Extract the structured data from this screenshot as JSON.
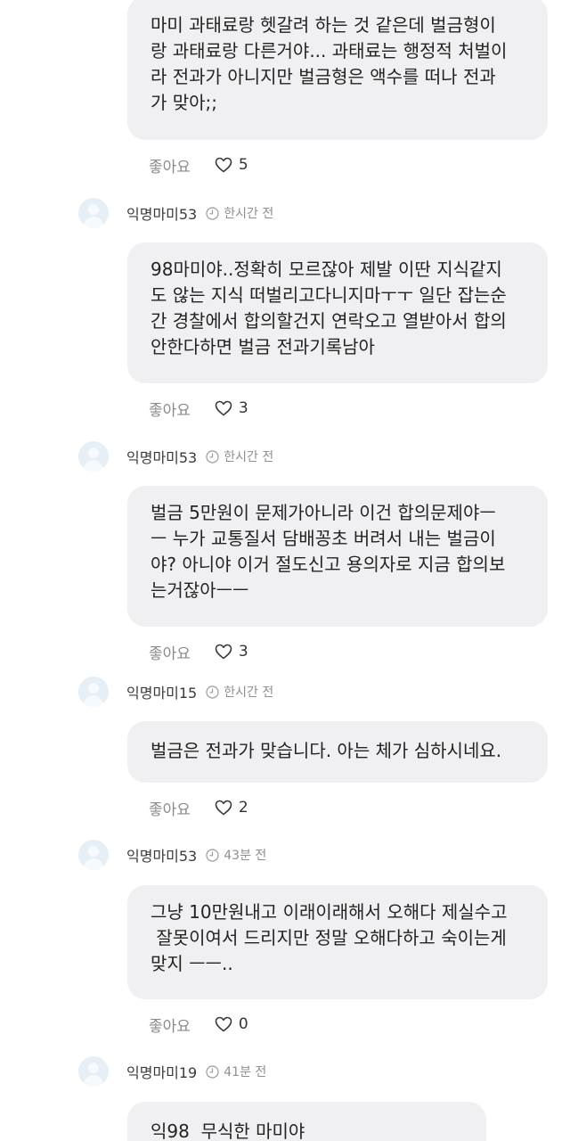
{
  "comments": [
    {
      "username": "",
      "time": "",
      "text": "마미 과태료랑 헷갈려 하는 것 같은데 벌금형이\n랑 과태료랑 다른거야... 과태료는 행정적 처벌이\n라 전과가 아니지만 벌금형은 액수를 떠나 전과\n가 맞아;;",
      "like_label": "좋아요",
      "like_count": "5"
    },
    {
      "username": "익명마미53",
      "time": "한시간 전",
      "text": "98마미야..정확히 모르잖아 제발 이딴 지식같지\n도 않는 지식 떠벌리고다니지마ㅜㅜ 일단 잡는순\n간 경찰에서 합의할건지 연락오고 열받아서 합의\n안한다하면 벌금 전과기록남아",
      "like_label": "좋아요",
      "like_count": "3"
    },
    {
      "username": "익명마미53",
      "time": "한시간 전",
      "text": "벌금 5만원이 문제가아니라 이건 합의문제야ㅡ\nㅡ 누가 교통질서 담배꽁초 버려서 내는 벌금이\n야? 아니야 이거 절도신고 용의자로 지금 합의보\n는거잖아ㅡㅡ",
      "like_label": "좋아요",
      "like_count": "3"
    },
    {
      "username": "익명마미15",
      "time": "한시간 전",
      "text": "벌금은 전과가 맞습니다. 아는 체가 심하시네요.",
      "like_label": "좋아요",
      "like_count": "2"
    },
    {
      "username": "익명마미53",
      "time": "43분 전",
      "text": "그냥 10만원내고 이래이래해서 오해다 제실수고\n 잘못이여서 드리지만 정말 오해다하고 숙이는게\n맞지 ㅡㅡ..",
      "like_label": "좋아요",
      "like_count": "0"
    },
    {
      "username": "익명마미19",
      "time": "41분 전",
      "text": "익98  무식한 마미야",
      "like_label": "",
      "like_count": ""
    }
  ],
  "colors": {
    "bubble_bg": "#f0f0f2",
    "avatar_bg": "#e6eef6",
    "muted_text": "#8a8a8a"
  },
  "icons": {
    "avatar": "default-user-avatar-icon",
    "time": "clock-icon",
    "like": "heart-outline-icon"
  }
}
